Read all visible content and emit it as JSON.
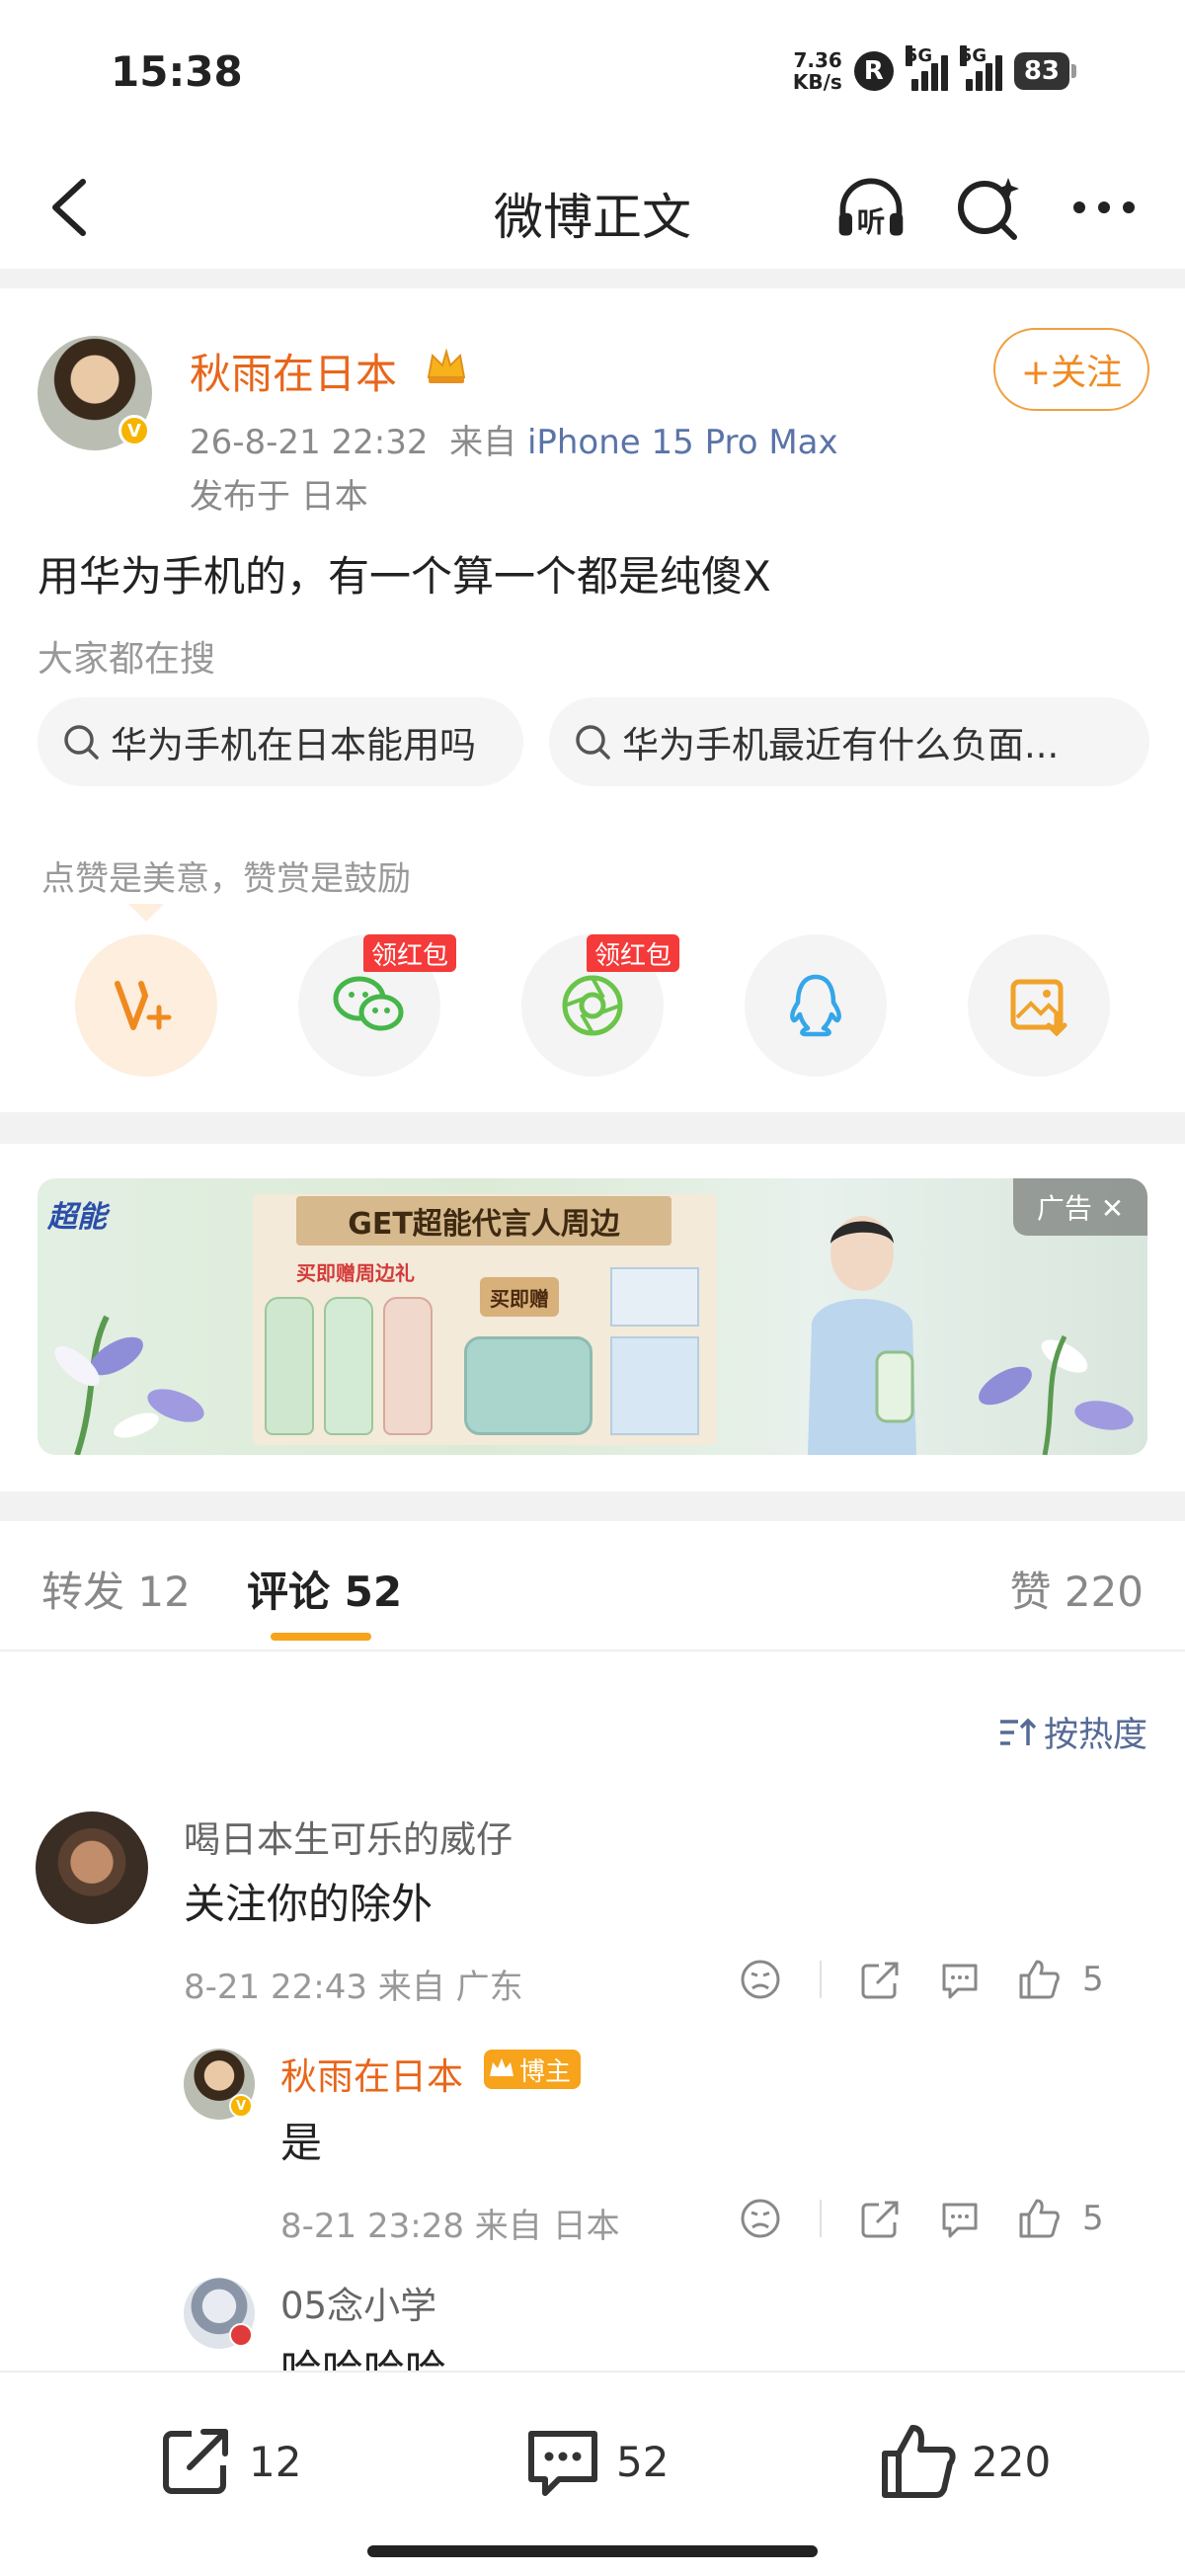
{
  "status_bar": {
    "time": "15:38",
    "net_speed_value": "7.36",
    "net_speed_unit": "KB/s",
    "r_badge": "R",
    "sim1": "5G",
    "sim2": "5G",
    "battery": "83"
  },
  "nav": {
    "title": "微博正文",
    "listen_label": "听"
  },
  "post": {
    "author": "秋雨在日本",
    "time": "26-8-21 22:32",
    "source_prefix": "来自",
    "device": "iPhone 15 Pro Max",
    "location": "发布于 日本",
    "follow_label": "+关注",
    "text": "用华为手机的，有一个算一个都是纯傻X"
  },
  "hot_search": {
    "title": "大家都在搜",
    "chips": [
      "华为手机在日本能用吗",
      "华为手机最近有什么负面..."
    ]
  },
  "share": {
    "praise_text": "点赞是美意，赞赏是鼓励",
    "red_packet_label": "领红包",
    "items": [
      "reward-icon",
      "wechat-icon",
      "moments-icon",
      "qq-icon",
      "save-image-icon"
    ]
  },
  "ad": {
    "brand": "超能",
    "banner": "GET超能代言人周边",
    "promo": "买即赠周边礼",
    "buy_label": "买即赠",
    "tag": "广告 ✕"
  },
  "tabs": {
    "repost": "转发 12",
    "comment": "评论 52",
    "like": "赞 220"
  },
  "sort_label": "按热度",
  "comments": [
    {
      "name": "喝日本生可乐的威仔",
      "text": "关注你的除外",
      "meta": "8-21 22:43  来自 广东",
      "likes": "5"
    },
    {
      "name": "秋雨在日本",
      "badge": "博主",
      "text": "是",
      "meta": "8-21 23:28  来自 日本",
      "likes": "5"
    },
    {
      "name": "05念小学",
      "text": "哈哈哈哈"
    }
  ],
  "bottom_bar": {
    "repost_count": "12",
    "comment_count": "52",
    "like_count": "220"
  },
  "colors": {
    "accent_orange": "#f7a31b",
    "name_orange": "#e8661a",
    "link_blue": "#5a74a8",
    "red_tag": "#f53a3a"
  }
}
